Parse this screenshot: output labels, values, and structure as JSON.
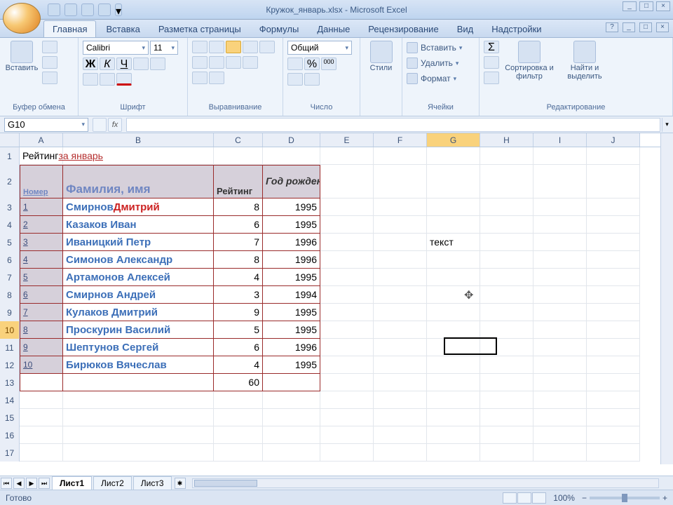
{
  "title": "Кружок_январь.xlsx - Microsoft Excel",
  "qat": [
    "undo",
    "redo",
    "save",
    "open",
    "more"
  ],
  "window_buttons": [
    "_",
    "□",
    "×"
  ],
  "ribbon": {
    "tabs": [
      "Главная",
      "Вставка",
      "Разметка страницы",
      "Формулы",
      "Данные",
      "Рецензирование",
      "Вид",
      "Надстройки"
    ],
    "active_tab": "Главная",
    "groups": {
      "clipboard": {
        "label": "Буфер обмена",
        "paste": "Вставить"
      },
      "font": {
        "label": "Шрифт",
        "name": "Calibri",
        "size": "11"
      },
      "align": {
        "label": "Выравнивание"
      },
      "number": {
        "label": "Число",
        "format": "Общий"
      },
      "styles": {
        "label": "Стили",
        "btn": "Стили"
      },
      "cells": {
        "label": "Ячейки",
        "insert": "Вставить",
        "delete": "Удалить",
        "format": "Формат"
      },
      "edit": {
        "label": "Редактирование",
        "sort": "Сортировка и фильтр",
        "find": "Найти и выделить"
      }
    }
  },
  "namebox": "G10",
  "formula": "",
  "columns": [
    "A",
    "B",
    "C",
    "D",
    "E",
    "F",
    "G",
    "H",
    "I",
    "J"
  ],
  "selected_col": "G",
  "selected_row": 10,
  "title_cell": {
    "prefix": "Рейтинг ",
    "link": "за январь"
  },
  "table": {
    "headers": {
      "num": "Номер",
      "name": "Фамилия, имя",
      "rating": "Рейтинг",
      "year": "Год рождения"
    },
    "rows": [
      {
        "n": "1",
        "name_a": "Смирнов ",
        "name_b": "Дмитрий",
        "r": "8",
        "y": "1995",
        "name_b_red": true
      },
      {
        "n": "2",
        "name_a": "Казаков Иван",
        "name_b": "",
        "r": "6",
        "y": "1995"
      },
      {
        "n": "3",
        "name_a": "Иваницкий Петр",
        "name_b": "",
        "r": "7",
        "y": "1996"
      },
      {
        "n": "4",
        "name_a": "Симонов Александр",
        "name_b": "",
        "r": "8",
        "y": "1996"
      },
      {
        "n": "5",
        "name_a": "Артамонов Алексей",
        "name_b": "",
        "r": "4",
        "y": "1995"
      },
      {
        "n": "6",
        "name_a": "Смирнов Андрей",
        "name_b": "",
        "r": "3",
        "y": "1994"
      },
      {
        "n": "7",
        "name_a": "Кулаков Дмитрий",
        "name_b": "",
        "r": "9",
        "y": "1995"
      },
      {
        "n": "8",
        "name_a": "Проскурин Василий",
        "name_b": "",
        "r": "5",
        "y": "1995"
      },
      {
        "n": "9",
        "name_a": "Шептунов Сергей",
        "name_b": "",
        "r": "6",
        "y": "1996"
      },
      {
        "n": "10",
        "name_a": "Бирюков Вячеслав",
        "name_b": "",
        "r": "4",
        "y": "1995"
      }
    ],
    "sum": "60"
  },
  "extra_text": "текст",
  "sheets": [
    "Лист1",
    "Лист2",
    "Лист3"
  ],
  "active_sheet": "Лист1",
  "status": {
    "ready": "Готово",
    "zoom": "100%"
  }
}
